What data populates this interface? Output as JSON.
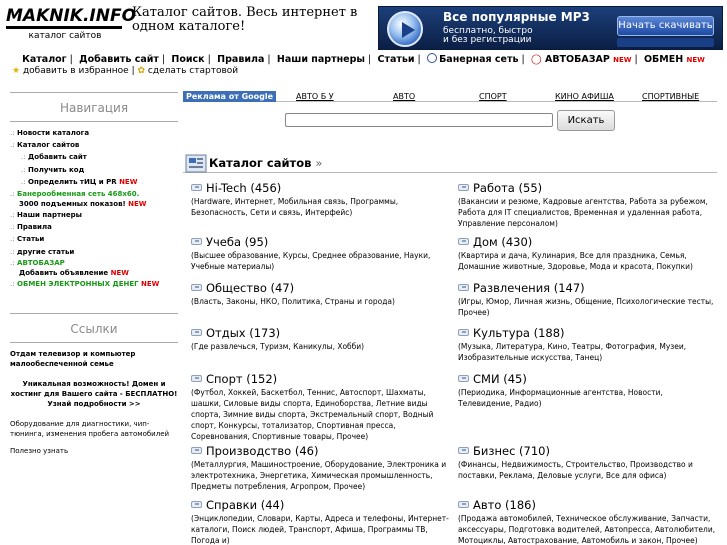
{
  "logo": {
    "wordmark": "MAKNIK.INFO",
    "subtitle": "каталог сайтов"
  },
  "tagline": "Каталог сайтов. Весь интернет в одном каталоге!",
  "banner": {
    "title": "Все популярные MP3",
    "subtitle": "бесплатно, быстро и без регистрации",
    "button": "Начать скачивать"
  },
  "topnav": {
    "items": [
      "Каталог",
      "Добавить сайт",
      "Поиск",
      "Правила",
      "Наши партнеры",
      "Статьи",
      "Банерная сеть",
      "АВТОБАЗАР",
      "ОБМЕН"
    ],
    "new_badge": "NEW"
  },
  "favorites": {
    "add_fav": "добавить в избранное",
    "sep": "|",
    "make_home": "сделать стартовой"
  },
  "sidebar": {
    "nav_title": "Навигация",
    "nav_items": [
      {
        "label": "Новости каталога"
      },
      {
        "label": "Каталог сайтов"
      },
      {
        "label": "Добавить сайт"
      },
      {
        "label": "Получить код"
      },
      {
        "label": "Определить тИЦ и PR"
      },
      {
        "label": "Банерообменная сеть 468х60."
      },
      {
        "label": "3000 подъемных показов!"
      },
      {
        "label": "Наши партнеры"
      },
      {
        "label": "Правила"
      },
      {
        "label": "Статьи"
      },
      {
        "label": "другие статьи"
      },
      {
        "label": "АВТОБАЗАР"
      },
      {
        "label": "Добавить объявление"
      },
      {
        "label": "ОБМЕН ЭЛЕКТРОННЫХ ДЕНЕГ"
      }
    ],
    "new_badge": "NEW",
    "links_title": "Ссылки",
    "ads": [
      "Отдам телевизор и компьютер малообеспеченной семье",
      "Уникальная возможность! Домен и хостинг для Вашего сайта - БЕСПЛАТНО! Узнай подробности >>",
      "Оборудование для диагностики, чип-тюнинга, изменения пробега автомобилей",
      "Полезно узнать"
    ]
  },
  "tabs": [
    "Реклама от Google",
    "АВТО Б У",
    "АВТО",
    "СПОРТ",
    "КИНО АФИША",
    "СПОРТИВНЫЕ"
  ],
  "search": {
    "value": "",
    "button": "Искать"
  },
  "catalog": {
    "title": "Каталог сайтов",
    "arrow": "»",
    "categories": [
      {
        "title": "Hi-Tech (456)",
        "desc": "(Hardware, Интернет, Мобильная связь, Программы, Безопасность, Сети и связь, Интерфейс)"
      },
      {
        "title": "Работа (55)",
        "desc": "(Вакансии и резюме, Кадровые агентства, Работа за рубежом, Работа для IT специалистов, Временная и удаленная работа, Управление персоналом)"
      },
      {
        "title": "Учеба (95)",
        "desc": "(Высшее образование, Курсы, Среднее образование, Науки, Учебные материалы)"
      },
      {
        "title": "Дом (430)",
        "desc": "(Квартира и дача, Кулинария, Все для праздника, Семья, Домашние животные, Здоровье, Мода и красота, Покупки)"
      },
      {
        "title": "Общество (47)",
        "desc": "(Власть, Законы, НКО, Политика, Страны и города)"
      },
      {
        "title": "Развлечения (147)",
        "desc": "(Игры, Юмор, Личная жизнь, Общение, Психологические тесты, Прочее)"
      },
      {
        "title": "Отдых (173)",
        "desc": "(Где развлечься, Туризм, Каникулы, Хобби)"
      },
      {
        "title": "Культура (188)",
        "desc": "(Музыка, Литература, Кино, Театры, Фотография, Музеи, Изобразительные искусства, Танец)"
      },
      {
        "title": "Спорт (152)",
        "desc": "(Футбол, Хоккей, Баскетбол, Теннис, Автоспорт, Шахматы, шашки, Силовые виды спорта, Единоборства, Летние виды спорта, Зимние виды спорта, Экстремальный спорт, Водный спорт, Конкурсы, тотализатор, Спортивная пресса, Соревнования, Спортивные товары, Прочее)"
      },
      {
        "title": "СМИ (45)",
        "desc": "(Периодика, Информационные агентства, Новости, Телевидение, Радио)"
      },
      {
        "title": "Производство (46)",
        "desc": "(Металлургия, Машиностроение, Оборудование, Электроника и электротехника, Энергетика, Химическая промышленность, Предметы потребления, Агропром, Прочее)"
      },
      {
        "title": "Бизнес (710)",
        "desc": "(Финансы, Недвижимость, Строительство, Производство и поставки, Реклама, Деловые услуги, Все для офиса)"
      },
      {
        "title": "Справки (44)",
        "desc": "(Энциклопедии, Словари, Карты, Адреса и телефоны, Интернет-каталоги, Поиск людей, Транспорт, Афиша, Программы ТВ, Погода и)"
      },
      {
        "title": "Авто (186)",
        "desc": "(Продажа автомобилей, Техническое обслуживание, Запчасти, аксессуары, Подготовка водителей, Автопресса, Автолюбители, Мотоциклы, Автострахование, Автомобиль и закон, Прочее)"
      }
    ]
  }
}
